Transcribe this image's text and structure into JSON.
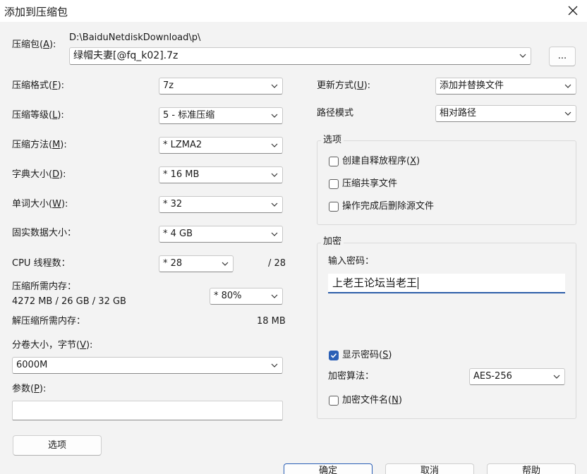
{
  "window": {
    "title": "添加到压缩包"
  },
  "archive": {
    "label_pre": "压缩包(",
    "label_key": "A",
    "label_post": "):",
    "path": "D:\\BaiduNetdiskDownload\\p\\",
    "name": "绿帽夫妻[@fq_k02].7z",
    "browse_label": "..."
  },
  "format": {
    "label_pre": "压缩格式(",
    "label_key": "F",
    "label_post": "):",
    "value": "7z"
  },
  "level": {
    "label_pre": "压缩等级(",
    "label_key": "L",
    "label_post": "):",
    "value": "5 - 标准压缩"
  },
  "method": {
    "label_pre": "压缩方法(",
    "label_key": "M",
    "label_post": "):",
    "value": "* LZMA2"
  },
  "dict": {
    "label_pre": "字典大小(",
    "label_key": "D",
    "label_post": "):",
    "value": "* 16 MB"
  },
  "word": {
    "label_pre": "单词大小(",
    "label_key": "W",
    "label_post": "):",
    "value": "* 32"
  },
  "solid": {
    "label": "固实数据大小：",
    "value": "* 4 GB"
  },
  "threads": {
    "label": "CPU 线程数：",
    "value": "* 28",
    "max": "/ 28"
  },
  "memory": {
    "label": "压缩所需内存：",
    "detail": "4272 MB / 26 GB / 32 GB",
    "value": "* 80%"
  },
  "decompress_memory": {
    "label": "解压缩所需内存：",
    "value": "18 MB"
  },
  "volume": {
    "label_pre": "分卷大小，字节(",
    "label_key": "V",
    "label_post": "):",
    "value": "6000M"
  },
  "params": {
    "label_pre": "参数(",
    "label_key": "P",
    "label_post": "):",
    "value": ""
  },
  "options_button": "选项",
  "update": {
    "label_pre": "更新方式(",
    "label_key": "U",
    "label_post": "):",
    "value": "添加并替换文件"
  },
  "path_mode": {
    "label": "路径模式",
    "value": "相对路径"
  },
  "options_group": {
    "title": "选项",
    "sfx": {
      "label_pre": "创建自释放程序(",
      "label_key": "X",
      "label_post": ")",
      "checked": false
    },
    "shared": {
      "label": "压缩共享文件",
      "checked": false
    },
    "delete": {
      "label": "操作完成后删除源文件",
      "checked": false
    }
  },
  "encryption": {
    "title": "加密",
    "password_label": "输入密码：",
    "password_value": "上老王论坛当老王",
    "show_password": {
      "label_pre": "显示密码(",
      "label_key": "S",
      "label_post": ")",
      "checked": true
    },
    "method_label": "加密算法：",
    "method_value": "AES-256",
    "encrypt_names": {
      "label_pre": "加密文件名(",
      "label_key": "N",
      "label_post": ")",
      "checked": false
    }
  },
  "buttons": {
    "ok": "确定",
    "cancel": "取消",
    "help": "帮助"
  },
  "colors": {
    "accent": "#2a5fb6",
    "background": "#f3f3f3"
  }
}
